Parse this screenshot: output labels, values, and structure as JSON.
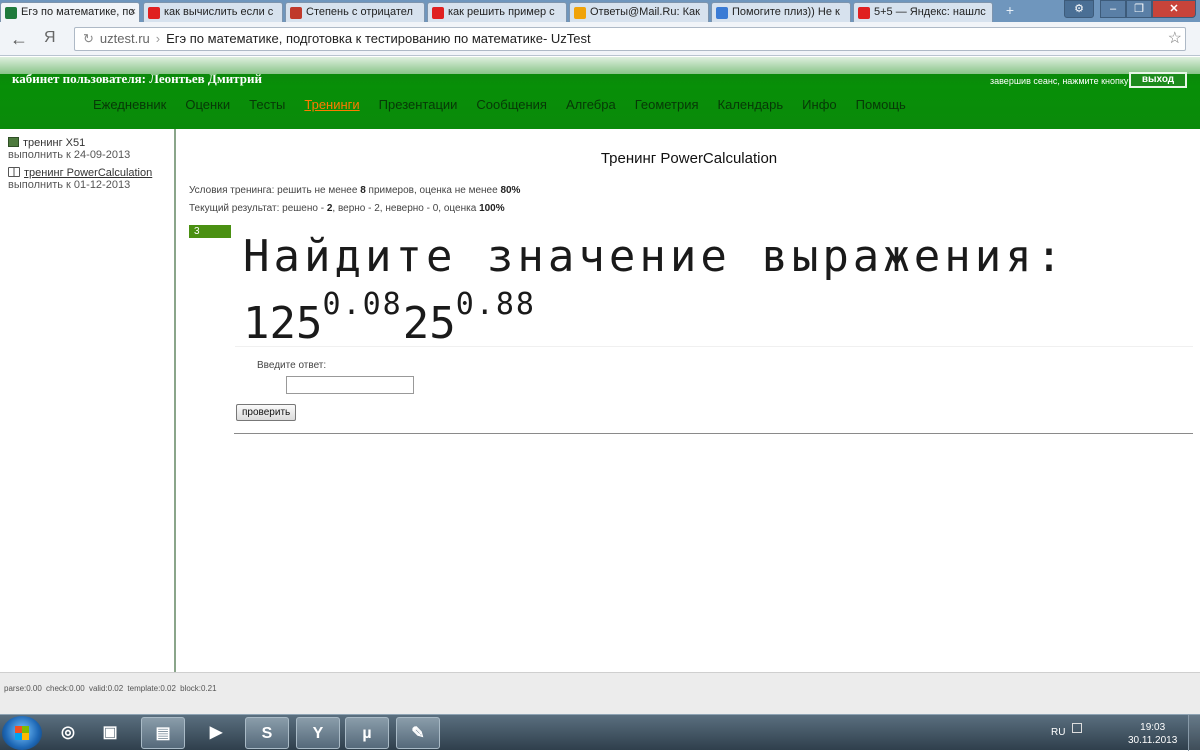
{
  "browser": {
    "tabs": [
      {
        "label": "Егэ по математике, по",
        "icon": "uztest-icon",
        "color": "#1f7a3c",
        "active": true,
        "close": "×"
      },
      {
        "label": "как вычислить если с",
        "icon": "yandex-icon",
        "color": "#e02020",
        "active": false,
        "close": ""
      },
      {
        "label": "Степень с отрицател",
        "icon": "x-site-icon",
        "color": "#c0392b",
        "active": false,
        "close": ""
      },
      {
        "label": "как решить пример с",
        "icon": "yandex-icon",
        "color": "#e02020",
        "active": false,
        "close": ""
      },
      {
        "label": "Ответы@Mail.Ru: Как",
        "icon": "mailru-answers-icon",
        "color": "#f0a30a",
        "active": false,
        "close": ""
      },
      {
        "label": "Помогите плиз)) Не к",
        "icon": "znanija-icon",
        "color": "#3a7bd5",
        "active": false,
        "close": ""
      },
      {
        "label": "5+5 — Яндекс: нашлс",
        "icon": "yandex-icon",
        "color": "#e02020",
        "active": false,
        "close": ""
      }
    ],
    "address": {
      "domain": "uztest.ru",
      "separator": "›",
      "page_title": "Егэ по математике, подготовка к тестированию по математике- UzTest"
    },
    "nav_back": "←",
    "yandex_button": "Я"
  },
  "header": {
    "cabinet": "кабинет пользователя: Леонтьев Дмитрий",
    "logout_hint": "завершив сеанс, нажмите кнопку",
    "logout_button": "выход",
    "nav": [
      {
        "label": "Ежедневник",
        "active": false
      },
      {
        "label": "Оценки",
        "active": false
      },
      {
        "label": "Тесты",
        "active": false
      },
      {
        "label": "Тренинги",
        "active": true
      },
      {
        "label": "Презентации",
        "active": false
      },
      {
        "label": "Сообщения",
        "active": false
      },
      {
        "label": "Алгебра",
        "active": false
      },
      {
        "label": "Геометрия",
        "active": false
      },
      {
        "label": "Календарь",
        "active": false
      },
      {
        "label": "Инфо",
        "active": false
      },
      {
        "label": "Помощь",
        "active": false
      }
    ]
  },
  "sidebar": {
    "tasks": [
      {
        "name": "тренинг X51",
        "due": "выполнить к 24-09-2013",
        "link": false
      },
      {
        "name": "тренинг PowerCalculation",
        "due": "выполнить к 01-12-2013",
        "link": true
      }
    ]
  },
  "training": {
    "title": "Тренинг PowerCalculation",
    "conditions": {
      "prefix": "Условия тренинга: решить не менее ",
      "min_examples": "8",
      "middle": " примеров, оценка не менее ",
      "min_grade": "80%"
    },
    "result": {
      "prefix": "Текущий результат: решено - ",
      "solved": "2",
      "rest": ", верно - 2, неверно - 0, оценка ",
      "grade": "100%"
    },
    "question_number": "3",
    "task_text": "Найдите значение выражения:",
    "expression": {
      "base1": "125",
      "exp1": "0.08",
      "base2": "25",
      "exp2": "0.88"
    },
    "answer_label": "Введите ответ:",
    "answer_value": "",
    "check_button": "проверить"
  },
  "stats": "parse:0.00  check:0.00  valid:0.02  template:0.02  block:0.21",
  "taskbar": {
    "language": "RU",
    "time": "19:03",
    "date": "30.11.2013",
    "apps": [
      {
        "name": "explorer-icon",
        "glyph": "◎"
      },
      {
        "name": "store-icon",
        "glyph": "▣"
      },
      {
        "name": "folder-icon",
        "glyph": "▤"
      },
      {
        "name": "media-player-icon",
        "glyph": "▶"
      },
      {
        "name": "skype-icon",
        "glyph": "S"
      },
      {
        "name": "yandex-browser-icon",
        "glyph": "Y"
      },
      {
        "name": "utorrent-icon",
        "glyph": "µ"
      },
      {
        "name": "paint-icon",
        "glyph": "✎"
      }
    ]
  }
}
